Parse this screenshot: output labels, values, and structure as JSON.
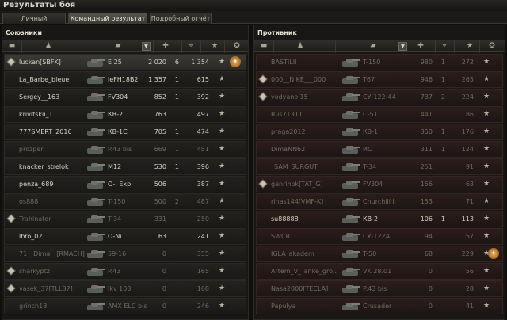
{
  "window": {
    "title": "Результаты боя"
  },
  "tabs": [
    {
      "label": "Личный результат",
      "active": false
    },
    {
      "label": "Командный результат",
      "active": true
    },
    {
      "label": "Подробный отчёт",
      "active": false
    }
  ],
  "icons": {
    "squad": "player-icon",
    "tank_header": "tank-icon",
    "damage": "damage-icon",
    "kills": "kills-icon",
    "xp": "star-icon",
    "sort": "sort-icon",
    "medal": "medal-icon",
    "platoon": "platoon-icon"
  },
  "allies": {
    "title": "Союзники",
    "players": [
      {
        "name": "luckan[SBFK]",
        "tank": "E 25",
        "damage": "2 020",
        "kills": "6",
        "xp": "1 354",
        "platoon": true,
        "medal": true,
        "dead": false
      },
      {
        "name": "La_Barbe_bleue",
        "tank": "leFH18B2",
        "damage": "1 357",
        "kills": "1",
        "xp": "615",
        "platoon": false,
        "medal": false,
        "dead": false
      },
      {
        "name": "Sergey__163",
        "tank": "FV304",
        "damage": "852",
        "kills": "1",
        "xp": "392",
        "platoon": false,
        "medal": false,
        "dead": false
      },
      {
        "name": "krivitskii_1",
        "tank": "КВ-2",
        "damage": "763",
        "kills": "",
        "xp": "497",
        "platoon": false,
        "medal": false,
        "dead": false
      },
      {
        "name": "777SMERT_2016",
        "tank": "КВ-1С",
        "damage": "705",
        "kills": "1",
        "xp": "474",
        "platoon": false,
        "medal": false,
        "dead": false
      },
      {
        "name": "prozper",
        "tank": "P.43 bis",
        "damage": "669",
        "kills": "1",
        "xp": "451",
        "platoon": false,
        "medal": false,
        "dead": true
      },
      {
        "name": "knacker_strelok",
        "tank": "M12",
        "damage": "530",
        "kills": "1",
        "xp": "396",
        "platoon": false,
        "medal": false,
        "dead": false
      },
      {
        "name": "penza_689",
        "tank": "O-I Exp.",
        "damage": "506",
        "kills": "",
        "xp": "387",
        "platoon": false,
        "medal": false,
        "dead": false
      },
      {
        "name": "os888",
        "tank": "T-150",
        "damage": "500",
        "kills": "2",
        "xp": "487",
        "platoon": false,
        "medal": false,
        "dead": true
      },
      {
        "name": "Trahinator",
        "tank": "T-34",
        "damage": "331",
        "kills": "",
        "xp": "250",
        "platoon": true,
        "medal": false,
        "dead": true
      },
      {
        "name": "lbro_02",
        "tank": "O-Ni",
        "damage": "63",
        "kills": "1",
        "xp": "241",
        "platoon": false,
        "medal": false,
        "dead": false
      },
      {
        "name": "71__Dima__[RMACH]",
        "tank": "59-16",
        "damage": "0",
        "kills": "",
        "xp": "355",
        "platoon": false,
        "medal": false,
        "dead": true
      },
      {
        "name": "sharkyptz",
        "tank": "P.43",
        "damage": "0",
        "kills": "",
        "xp": "165",
        "platoon": true,
        "medal": false,
        "dead": true
      },
      {
        "name": "vasek_37[TLL37]",
        "tank": "lkv 103",
        "damage": "0",
        "kills": "",
        "xp": "168",
        "platoon": true,
        "medal": false,
        "dead": true
      },
      {
        "name": "grinch18",
        "tank": "AMX ELC bis",
        "damage": "0",
        "kills": "",
        "xp": "246",
        "platoon": false,
        "medal": false,
        "dead": true
      }
    ]
  },
  "enemies": {
    "title": "Противник",
    "players": [
      {
        "name": "BASTILII",
        "tank": "T-150",
        "damage": "980",
        "kills": "1",
        "xp": "272",
        "platoon": false,
        "medal": false,
        "dead": true
      },
      {
        "name": "000__NIKE___000",
        "tank": "T67",
        "damage": "946",
        "kills": "1",
        "xp": "265",
        "platoon": true,
        "medal": false,
        "dead": true
      },
      {
        "name": "vodyanoi15",
        "tank": "СУ-122-44",
        "damage": "737",
        "kills": "2",
        "xp": "224",
        "platoon": true,
        "medal": false,
        "dead": true
      },
      {
        "name": "Rus71311",
        "tank": "С-51",
        "damage": "441",
        "kills": "",
        "xp": "86",
        "platoon": false,
        "medal": false,
        "dead": true
      },
      {
        "name": "praga2012",
        "tank": "КВ-1",
        "damage": "350",
        "kills": "1",
        "xp": "176",
        "platoon": false,
        "medal": false,
        "dead": true
      },
      {
        "name": "DimaNN62",
        "tank": "ИС",
        "damage": "311",
        "kills": "1",
        "xp": "124",
        "platoon": false,
        "medal": false,
        "dead": true
      },
      {
        "name": "_SAM_SURGUT",
        "tank": "T-34",
        "damage": "251",
        "kills": "",
        "xp": "91",
        "platoon": false,
        "medal": false,
        "dead": true
      },
      {
        "name": "genrihok[TAT_G]",
        "tank": "FV304",
        "damage": "156",
        "kills": "",
        "xp": "63",
        "platoon": true,
        "medal": false,
        "dead": true
      },
      {
        "name": "rinas144[VMF-K]",
        "tank": "Churchill I",
        "damage": "153",
        "kills": "",
        "xp": "71",
        "platoon": false,
        "medal": false,
        "dead": true
      },
      {
        "name": "su88888",
        "tank": "КВ-2",
        "damage": "106",
        "kills": "1",
        "xp": "113",
        "platoon": false,
        "medal": false,
        "dead": false
      },
      {
        "name": "SWCR",
        "tank": "СУ-122А",
        "damage": "94",
        "kills": "",
        "xp": "57",
        "platoon": false,
        "medal": false,
        "dead": true
      },
      {
        "name": "IGLA_akadem",
        "tank": "T-50",
        "damage": "68",
        "kills": "",
        "xp": "229",
        "platoon": false,
        "medal": true,
        "dead": true
      },
      {
        "name": "Artem_V_Tanke_gro..",
        "tank": "VK 28.01",
        "damage": "0",
        "kills": "",
        "xp": "56",
        "platoon": false,
        "medal": false,
        "dead": true
      },
      {
        "name": "Nasa2000[TECLA]",
        "tank": "P.43 bis",
        "damage": "0",
        "kills": "",
        "xp": "28",
        "platoon": false,
        "medal": false,
        "dead": true
      },
      {
        "name": "Papulya",
        "tank": "Crusader",
        "damage": "0",
        "kills": "",
        "xp": "41",
        "platoon": false,
        "medal": false,
        "dead": true
      }
    ]
  }
}
